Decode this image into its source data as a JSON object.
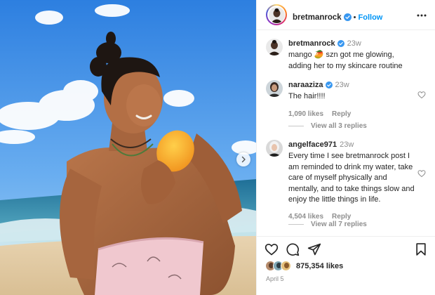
{
  "post": {
    "author": "bretmanrock",
    "follow_label": "Follow",
    "separator": "•",
    "caption_author": "bretmanrock",
    "caption_time": "23w",
    "caption_text": "mango 🥭 szn got me glowing, adding her to my skincare routine"
  },
  "comments": [
    {
      "username": "naraaziza",
      "time": "23w",
      "text": "The hair!!!!",
      "likes": "1,090 likes",
      "reply_label": "Reply",
      "view_replies": "View all 3 replies"
    },
    {
      "username": "angelface971",
      "time": "23w",
      "text": "Every time I see bretmanrock post I am reminded to drink my water, take care of myself physically and mentally, and to take things slow and enjoy the little things in life.",
      "likes": "4,504 likes",
      "reply_label": "Reply",
      "view_replies": "View all 7 replies"
    }
  ],
  "footer": {
    "likes_count": "875,354 likes",
    "date": "April 5"
  },
  "icons": {
    "verified": "verified-badge-icon",
    "more": "more-options-icon",
    "like": "heart-icon",
    "comment": "comment-icon",
    "share": "share-icon",
    "save": "bookmark-icon",
    "next": "chevron-right-icon"
  },
  "colors": {
    "link_blue": "#0095f6",
    "verified_blue": "#3897f0",
    "muted_text": "#8e8e8e",
    "text": "#262626"
  }
}
